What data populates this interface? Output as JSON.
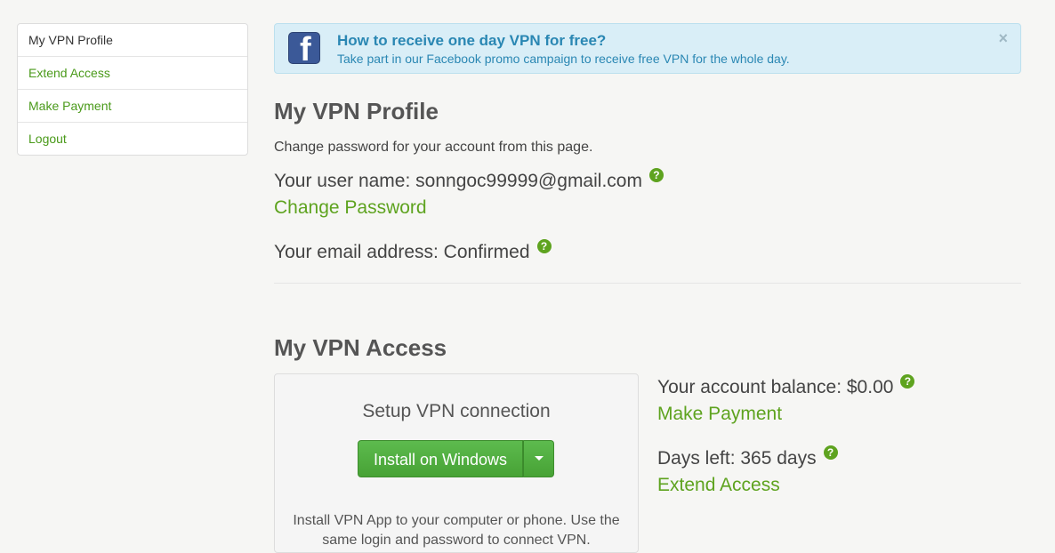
{
  "sidebar": {
    "items": [
      {
        "label": "My VPN Profile"
      },
      {
        "label": "Extend Access"
      },
      {
        "label": "Make Payment"
      },
      {
        "label": "Logout"
      }
    ]
  },
  "banner": {
    "title": "How to receive one day VPN for free?",
    "text": "Take part in our Facebook promo campaign to receive free VPN for the whole day.",
    "close": "×",
    "logo_letter": "f"
  },
  "profile": {
    "heading": "My VPN Profile",
    "description": "Change password for your account from this page.",
    "username_label": "Your user name: sonngoc99999@gmail.com",
    "change_password": "Change Password",
    "email_label": "Your email address: Confirmed"
  },
  "access": {
    "heading": "My VPN Access",
    "setup_title": "Setup VPN connection",
    "install_button": "Install on Windows",
    "setup_desc": "Install VPN App to your computer or phone. Use the same login and password to connect VPN.",
    "balance_label": "Your account balance: $0.00",
    "make_payment": "Make Payment",
    "days_left": "Days left: 365 days",
    "extend_access": "Extend Access"
  },
  "help_glyph": "?",
  "colors": {
    "accent_green": "#5ea31f",
    "button_green": "#47a235",
    "banner_bg": "#d9eef7",
    "banner_text": "#2a87b3",
    "facebook_blue": "#3b5998"
  }
}
